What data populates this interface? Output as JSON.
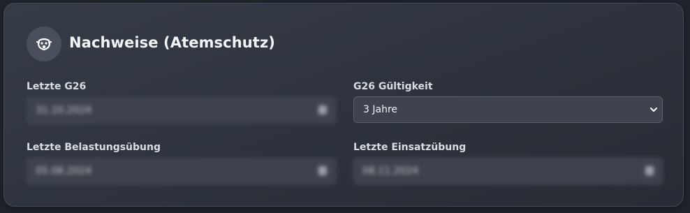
{
  "section": {
    "title": "Nachweise (Atemschutz)",
    "icon": "respirator-mask-icon"
  },
  "fields": {
    "letzte_g26": {
      "label": "Letzte G26",
      "value": "31.10.2024"
    },
    "g26_gueltigkeit": {
      "label": "G26 Gültigkeit",
      "value": "3 Jahre"
    },
    "letzte_belastungsuebung": {
      "label": "Letzte Belastungsübung",
      "value": "05.08.2024"
    },
    "letzte_einsatzuebung": {
      "label": "Letzte Einsatzübung",
      "value": "08.11.2024"
    }
  },
  "colors": {
    "background": "#1f232b",
    "card": "#2f343e",
    "field": "#3d424c",
    "text": "#f2f3f5"
  }
}
